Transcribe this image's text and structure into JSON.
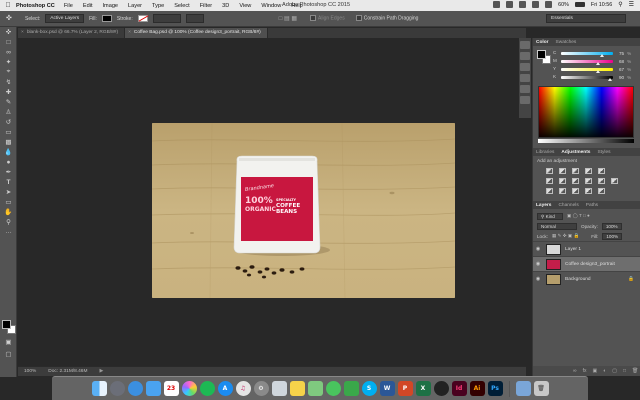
{
  "menubar": {
    "apple": "",
    "app_name": "Photoshop CC",
    "items": [
      "File",
      "Edit",
      "Image",
      "Layer",
      "Type",
      "Select",
      "Filter",
      "3D",
      "View",
      "Window",
      "Help"
    ],
    "window_title": "Adobe Photoshop CC 2015",
    "battery": "60%",
    "clock": "Fri 10:56"
  },
  "options_bar": {
    "select_label": "Select:",
    "select_value": "Active Layers",
    "fill_label": "Fill:",
    "stroke_label": "Stroke:",
    "align_edges": "Align Edges",
    "constrain_label": "Constrain Path Dragging",
    "workspace": "Essentials"
  },
  "tabs": [
    {
      "label": "blank-box.psd @ 66.7% (Layer 2, RGB/8#)",
      "active": false
    },
    {
      "label": "Coffee Bag.psd @ 100% (Coffee design3_portrait, RGB/8#)",
      "active": true
    }
  ],
  "status": {
    "zoom": "100%",
    "doc": "Doc: 2.31M/8.46M"
  },
  "color_panel": {
    "tabs": [
      "Color",
      "Swatches"
    ],
    "sliders": [
      {
        "label": "C",
        "value": "75",
        "fill": 0.75,
        "from": "#ffffff",
        "to": "#00aeef"
      },
      {
        "label": "M",
        "value": "68",
        "fill": 0.68,
        "from": "#ffffff",
        "to": "#ec008c"
      },
      {
        "label": "Y",
        "value": "67",
        "fill": 0.67,
        "from": "#ffffff",
        "to": "#fff200"
      },
      {
        "label": "K",
        "value": "90",
        "fill": 0.9,
        "from": "#ffffff",
        "to": "#000000"
      }
    ],
    "percent": "%"
  },
  "adjust_panel": {
    "tabs": [
      "Libraries",
      "Adjustments",
      "Styles"
    ],
    "caption": "Add an adjustment"
  },
  "layers_panel": {
    "tabs": [
      "Layers",
      "Channels",
      "Paths"
    ],
    "kind": "Kind",
    "blend_mode": "Normal",
    "opacity_label": "Opacity:",
    "opacity": "100%",
    "lock_label": "Lock:",
    "fill_label": "Fill:",
    "fill": "100%",
    "layers": [
      {
        "name": "Layer 1",
        "selected": false,
        "thumb": "#d8d8d8"
      },
      {
        "name": "Coffee design3_portrait",
        "selected": true,
        "thumb": "#c41e4a"
      },
      {
        "name": "Background",
        "selected": false,
        "thumb": "#b59e6c"
      }
    ]
  },
  "bag_text": {
    "brand": "Brandname",
    "line1": "100%",
    "line1b": "SPECIALTY",
    "line2": "ORGANIC",
    "line2b": "COFFEE",
    "line3": "BEANS"
  },
  "colors": {
    "accent_bag": "#c8173f",
    "wood": "#c2ab7a",
    "ui_panel": "#535353"
  },
  "dock_apps": [
    "finder-icon",
    "launchpad-icon",
    "safari-icon",
    "mail-icon",
    "calendar-icon",
    "photos-icon",
    "spotify-icon",
    "appstore-icon",
    "music-icon",
    "systemprefs-icon",
    "preview-icon",
    "stickies-icon",
    "maps-icon",
    "messages-icon",
    "facetime-icon",
    "skype-icon",
    "word-icon",
    "powerpoint-icon",
    "excel-icon",
    "unknown-icon",
    "indesign-icon",
    "illustrator-icon",
    "photoshop-icon",
    "downloads-icon",
    "trash-icon"
  ],
  "dock_labels": {
    "skype": "S",
    "word": "W",
    "ppt": "P",
    "excel": "X",
    "indesign": "Id",
    "illustrator": "Ai",
    "photoshop": "Ps"
  }
}
